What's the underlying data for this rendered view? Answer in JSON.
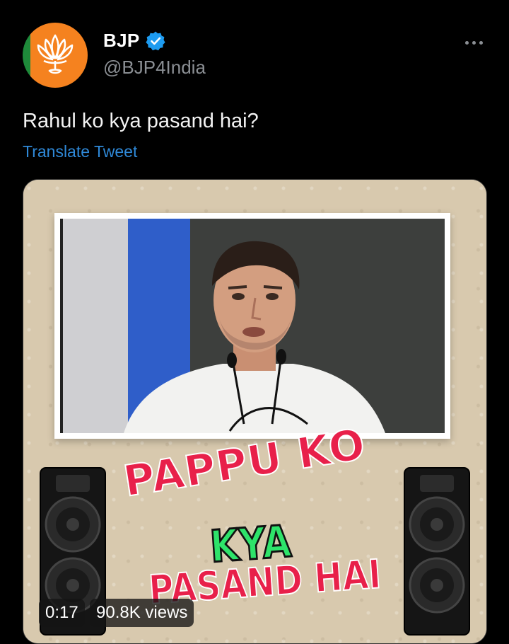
{
  "author": {
    "name": "BJP",
    "handle": "@BJP4India",
    "verified": true,
    "avatar_colors": {
      "background": "#f5821f",
      "stripe": "#1e8a3a"
    }
  },
  "tweet": {
    "text": "Rahul ko kya pasand hai?",
    "translate_label": "Translate Tweet"
  },
  "media": {
    "caption_line1": "PAPPU KO",
    "caption_line2": "KYA",
    "caption_line3": "PASAND HAI",
    "duration": "0:17",
    "views": "90.8K views"
  },
  "icons": {
    "verified": "verified-badge-icon",
    "more": "more-options-icon",
    "avatar_logo": "lotus-logo-icon",
    "speaker": "speaker-icon"
  }
}
